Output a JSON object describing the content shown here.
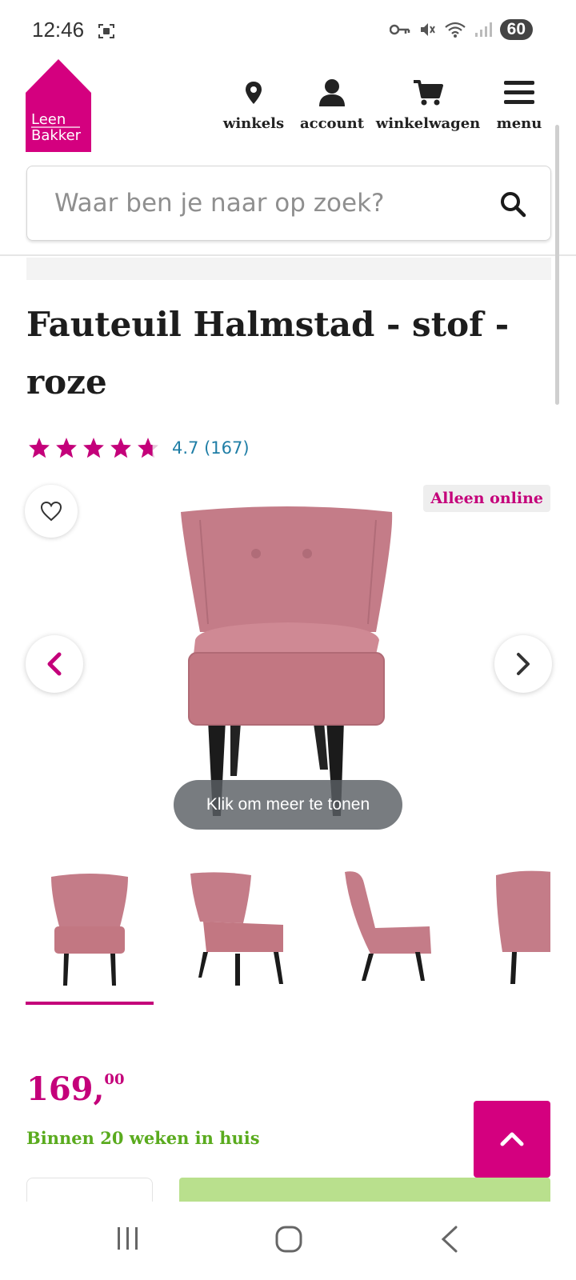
{
  "status_bar": {
    "time": "12:46",
    "battery": "60"
  },
  "header": {
    "brand_line1": "Leen",
    "brand_line2": "Bakker",
    "nav": {
      "stores": "winkels",
      "account": "account",
      "cart": "winkelwagen",
      "menu": "menu"
    }
  },
  "search": {
    "placeholder": "Waar ben je naar op zoek?"
  },
  "product": {
    "title": "Fauteuil Halmstad - stof - roze",
    "rating": 4.7,
    "rating_text": "4.7 (167)",
    "badge": "Alleen online",
    "show_more": "Klik om meer te tonen",
    "price_main": "169,",
    "price_cents": "00",
    "delivery": "Binnen 20 weken in huis"
  },
  "colors": {
    "brand": "#c4007a",
    "link": "#1f7ea6",
    "delivery_green": "#5aab1e",
    "chair_pink": "#c57c88"
  },
  "icons": [
    "location-pin-icon",
    "user-icon",
    "cart-icon",
    "menu-icon",
    "search-icon",
    "heart-icon",
    "chevron-left-icon",
    "chevron-right-icon",
    "chevron-up-icon"
  ]
}
